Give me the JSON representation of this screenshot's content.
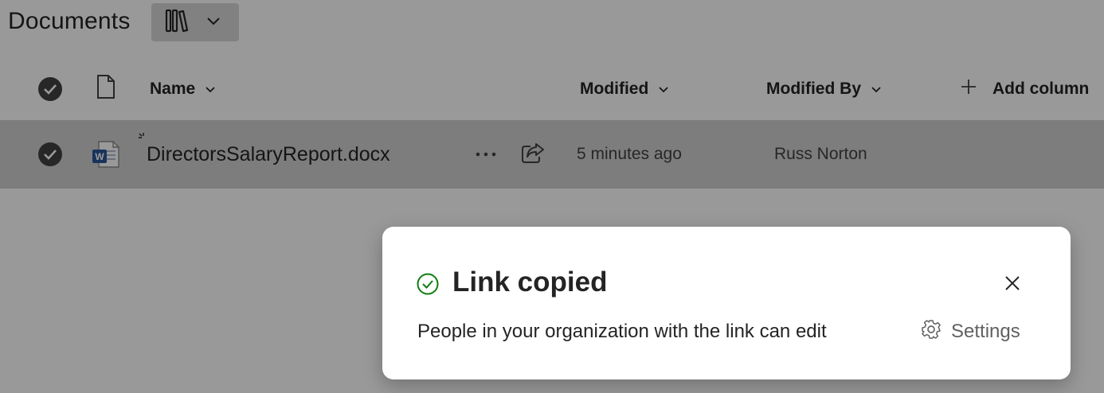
{
  "library": {
    "title": "Documents",
    "view_icon": "library-icon",
    "view_dropdown_icon": "chevron-down-icon"
  },
  "columns": {
    "name": "Name",
    "modified": "Modified",
    "modified_by": "Modified By",
    "add_column": "Add column"
  },
  "files": [
    {
      "name": "DirectorsSalaryReport.docx",
      "type_icon": "word-document-icon",
      "modified": "5 minutes ago",
      "modified_by": "Russ Norton",
      "selected": true
    }
  ],
  "toast": {
    "title": "Link copied",
    "message": "People in your organization with the link can edit",
    "settings_label": "Settings",
    "status_color": "#107c10"
  },
  "colors": {
    "overlay": "rgba(0,0,0,0.40)",
    "row_selected": "#d0d0d0",
    "word_blue": "#2b579a"
  }
}
